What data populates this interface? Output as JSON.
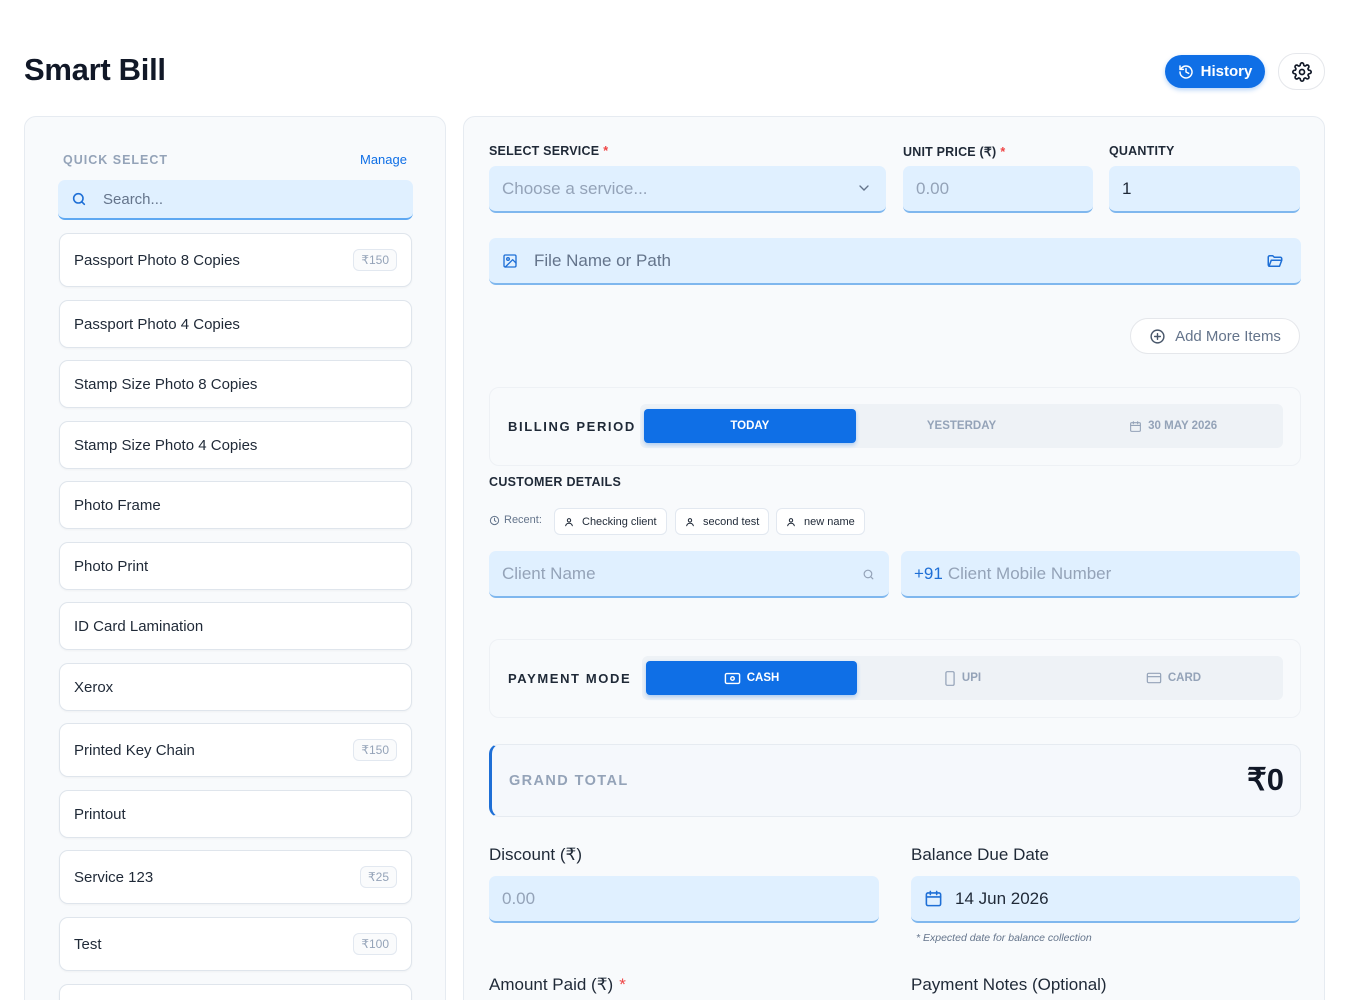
{
  "app": {
    "title": "Smart Bill"
  },
  "header": {
    "history_label": "History"
  },
  "quick_select": {
    "label": "QUICK SELECT",
    "manage": "Manage",
    "search_placeholder": "Search...",
    "items": [
      {
        "name": "Passport Photo 8 Copies",
        "price": "₹150"
      },
      {
        "name": "Passport Photo 4 Copies",
        "price": ""
      },
      {
        "name": "Stamp Size Photo 8 Copies",
        "price": ""
      },
      {
        "name": "Stamp Size Photo 4 Copies",
        "price": ""
      },
      {
        "name": "Photo Frame",
        "price": ""
      },
      {
        "name": "Photo Print",
        "price": ""
      },
      {
        "name": "ID Card Lamination",
        "price": ""
      },
      {
        "name": "Xerox",
        "price": ""
      },
      {
        "name": "Printed Key Chain",
        "price": "₹150"
      },
      {
        "name": "Printout",
        "price": ""
      },
      {
        "name": "Service 123",
        "price": "₹25"
      },
      {
        "name": "Test",
        "price": "₹100"
      }
    ]
  },
  "form": {
    "service_label": "SELECT SERVICE",
    "service_placeholder": "Choose a service...",
    "unit_price_label": "UNIT PRICE (₹)",
    "unit_price_placeholder": "0.00",
    "quantity_label": "QUANTITY",
    "quantity_value": "1",
    "required_mark": "*",
    "file_placeholder": "File Name or Path",
    "add_more_label": "Add More Items"
  },
  "billing": {
    "label": "BILLING PERIOD",
    "options": [
      "TODAY",
      "YESTERDAY",
      "30 MAY 2026"
    ],
    "active": 0
  },
  "customer": {
    "label": "CUSTOMER DETAILS",
    "recent_label": "Recent:",
    "recent": [
      "Checking client",
      "second test",
      "new name"
    ],
    "name_placeholder": "Client Name",
    "mobile_prefix": "+91",
    "mobile_placeholder": "Client Mobile Number"
  },
  "payment": {
    "label": "PAYMENT MODE",
    "options": [
      "CASH",
      "UPI",
      "CARD"
    ],
    "active": 0
  },
  "total": {
    "label": "GRAND TOTAL",
    "value": "₹0"
  },
  "discount": {
    "label": "Discount (₹)",
    "placeholder": "0.00"
  },
  "due_date": {
    "label": "Balance Due Date",
    "value": "14 Jun 2026",
    "hint": "* Expected date for balance collection"
  },
  "amount_paid": {
    "label": "Amount Paid (₹)"
  },
  "notes": {
    "label": "Payment Notes (Optional)"
  },
  "colors": {
    "accent": "#0f6fe6",
    "field_bg": "#e0f0ff",
    "required": "#ef4444"
  }
}
